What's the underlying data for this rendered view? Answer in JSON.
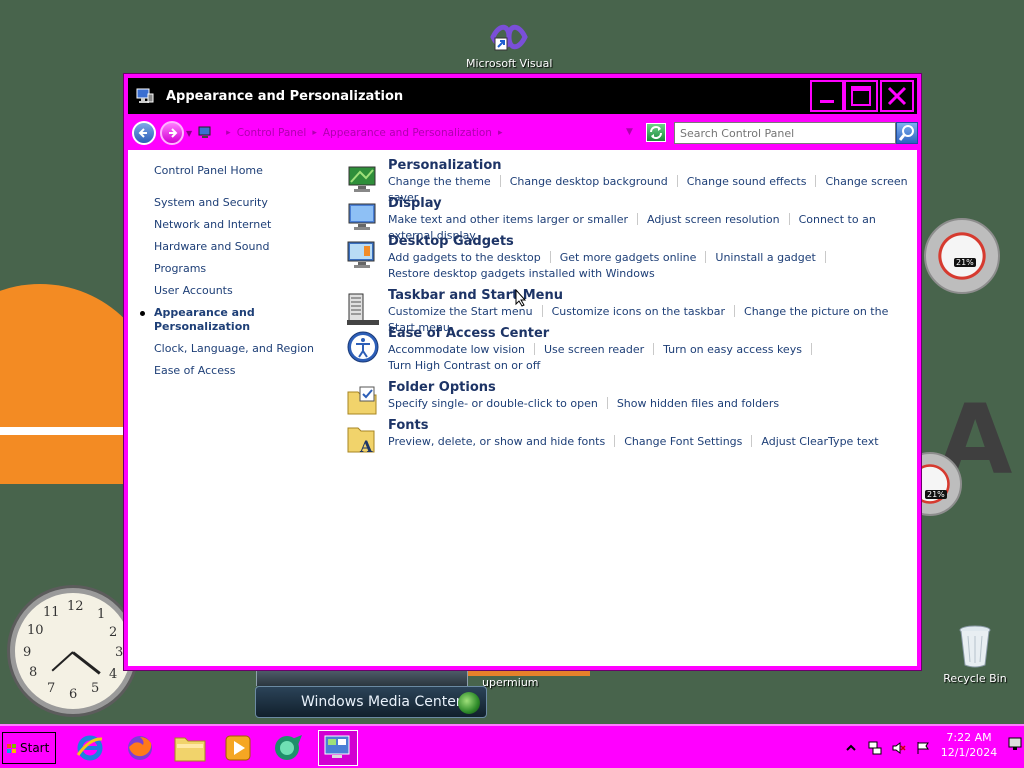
{
  "desktop": {
    "icons": [
      {
        "label": "Microsoft Visual",
        "icon": "visual-studio-icon"
      },
      {
        "label": "Recycle Bin",
        "icon": "recycle-bin-icon"
      }
    ],
    "gadgets": {
      "cpu_meter_1": "21%",
      "cpu_meter_2": "21%",
      "media_center_label": "Windows Media Center",
      "supermium_label": "upermium",
      "clock_numbers": [
        "12",
        "1",
        "2",
        "3",
        "4",
        "5",
        "6",
        "7",
        "8",
        "9",
        "10",
        "11"
      ]
    },
    "big_letter": "A"
  },
  "window": {
    "title": "Appearance and Personalization",
    "breadcrumb": [
      "Control Panel",
      "Appearance and Personalization"
    ],
    "search_placeholder": "Search Control Panel",
    "sidebar": {
      "home": "Control Panel Home",
      "items": [
        {
          "label": "System and Security",
          "active": false
        },
        {
          "label": "Network and Internet",
          "active": false
        },
        {
          "label": "Hardware and Sound",
          "active": false
        },
        {
          "label": "Programs",
          "active": false
        },
        {
          "label": "User Accounts",
          "active": false
        },
        {
          "label": "Appearance and Personalization",
          "active": true
        },
        {
          "label": "Clock, Language, and Region",
          "active": false
        },
        {
          "label": "Ease of Access",
          "active": false
        }
      ]
    },
    "categories": [
      {
        "title": "Personalization",
        "icon": "personalization-icon",
        "links": [
          "Change the theme",
          "Change desktop background",
          "Change sound effects",
          "Change screen saver"
        ]
      },
      {
        "title": "Display",
        "icon": "display-icon",
        "links": [
          "Make text and other items larger or smaller",
          "Adjust screen resolution",
          "Connect to an external display"
        ]
      },
      {
        "title": "Desktop Gadgets",
        "icon": "gadgets-icon",
        "links": [
          "Add gadgets to the desktop",
          "Get more gadgets online",
          "Uninstall a gadget",
          "Restore desktop gadgets installed with Windows"
        ]
      },
      {
        "title": "Taskbar and Start Menu",
        "icon": "taskbar-icon",
        "links": [
          "Customize the Start menu",
          "Customize icons on the taskbar",
          "Change the picture on the Start menu"
        ]
      },
      {
        "title": "Ease of Access Center",
        "icon": "ease-of-access-icon",
        "links": [
          "Accommodate low vision",
          "Use screen reader",
          "Turn on easy access keys",
          "Turn High Contrast on or off"
        ]
      },
      {
        "title": "Folder Options",
        "icon": "folder-options-icon",
        "links": [
          "Specify single- or double-click to open",
          "Show hidden files and folders"
        ]
      },
      {
        "title": "Fonts",
        "icon": "fonts-icon",
        "links": [
          "Preview, delete, or show and hide fonts",
          "Change Font Settings",
          "Adjust ClearType text"
        ]
      }
    ]
  },
  "taskbar": {
    "start_label": "Start",
    "pinned": [
      "internet-explorer-icon",
      "firefox-icon",
      "file-explorer-icon",
      "media-player-icon",
      "media-center-icon",
      "control-panel-icon"
    ],
    "tray_icons": [
      "chevron-up-icon",
      "network-icon",
      "volume-muted-icon",
      "flag-icon"
    ],
    "time": "7:22 AM",
    "date": "12/1/2024"
  },
  "colors": {
    "accent": "#ff00ff",
    "titlebar": "#000000",
    "link": "#1e3f77",
    "heading": "#1d3466",
    "desktop": "#48644c"
  }
}
